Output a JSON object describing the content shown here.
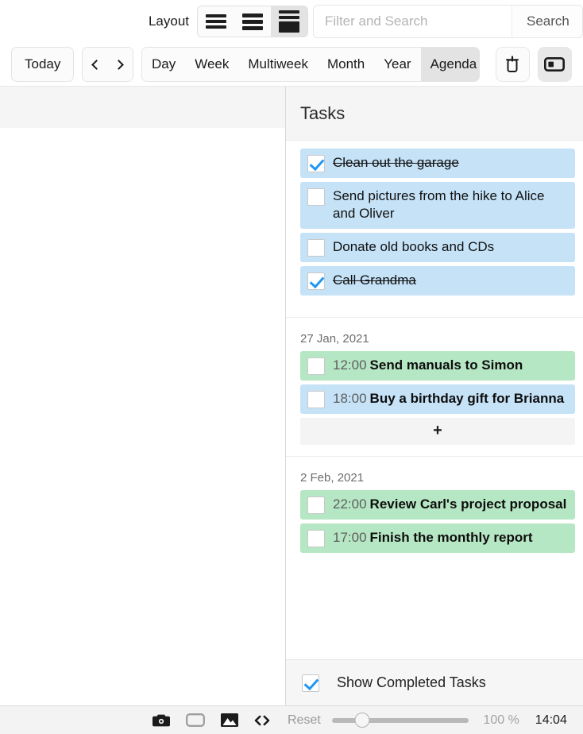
{
  "toolbar": {
    "layout_label": "Layout",
    "layout_options": [
      {
        "name": "layout-compact",
        "selected": false
      },
      {
        "name": "layout-medium",
        "selected": false
      },
      {
        "name": "layout-detailed",
        "selected": true
      }
    ],
    "search_placeholder": "Filter and Search",
    "search_value": "",
    "search_button": "Search",
    "today_label": "Today",
    "prev_label": "Previous",
    "next_label": "Next",
    "views": [
      {
        "label": "Day",
        "selected": false
      },
      {
        "label": "Week",
        "selected": false
      },
      {
        "label": "Multiweek",
        "selected": false
      },
      {
        "label": "Month",
        "selected": false
      },
      {
        "label": "Year",
        "selected": false
      },
      {
        "label": "Agenda",
        "selected": true
      }
    ],
    "delete_icon": "trash-icon",
    "panel_icon": "sidebar-panel-icon"
  },
  "tasks_panel": {
    "title": "Tasks",
    "items": [
      {
        "text": "Clean out the garage",
        "checked": true,
        "color": "blue"
      },
      {
        "text": "Send pictures from the hike to Alice and Oliver",
        "checked": false,
        "color": "blue"
      },
      {
        "text": "Donate old books and CDs",
        "checked": false,
        "color": "blue"
      },
      {
        "text": "Call Grandma",
        "checked": true,
        "color": "blue"
      }
    ]
  },
  "agenda": {
    "groups": [
      {
        "date": "27 Jan, 2021",
        "events": [
          {
            "time": "12:00",
            "title": "Send manuals to Simon",
            "checked": false,
            "color": "green"
          },
          {
            "time": "18:00",
            "title": "Buy a birthday gift for Brianna",
            "checked": false,
            "color": "blue"
          }
        ],
        "add_label": "+"
      },
      {
        "date": "2 Feb, 2021",
        "events": [
          {
            "time": "22:00",
            "title": "Review Carl's project proposal",
            "checked": false,
            "color": "green"
          },
          {
            "time": "17:00",
            "title": "Finish the monthly report",
            "checked": false,
            "color": "green"
          }
        ],
        "add_label": ""
      }
    ]
  },
  "show_completed": {
    "label": "Show Completed Tasks",
    "checked": true
  },
  "footer": {
    "icons": [
      "camera-icon",
      "window-icon",
      "image-icon",
      "code-icon"
    ],
    "reset_label": "Reset",
    "zoom_value": 100,
    "zoom_display": "100 %",
    "clock": "14:04"
  },
  "colors": {
    "task_blue": "#c5e2f7",
    "event_green": "#b6e7c4",
    "checkmark_blue": "#2196f3",
    "header_gray": "#f5f5f5",
    "footer_gray": "#f3f3f3"
  }
}
